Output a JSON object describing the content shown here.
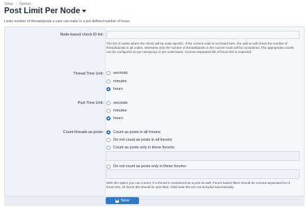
{
  "breadcrumb": {
    "items": [
      "Setup",
      "Options"
    ],
    "separator": "›"
  },
  "page": {
    "title": "Post Limit Per Node",
    "description": "Limits number of threads/posts a user can make in a pre-defined number of hours."
  },
  "fields": {
    "node_ids": {
      "label": "Node-based check ID list:",
      "value": "",
      "hint": "The list of nodes where the check will be node-specific. If the current node is not listed here, the add-on will check the number of threads/posts in all nodes, otherwise only the number of threads/posts in the current node will be considered. The appropriate counts can be configured on per-usergroup or per-node basis. Comma-separated list of forum IDs is expected."
    },
    "thread_time_unit": {
      "label": "Thread Time Unit:",
      "options": [
        "seconds",
        "minutes",
        "hours"
      ],
      "selected": "hours"
    },
    "post_time_unit": {
      "label": "Post Time Unit:",
      "options": [
        "seconds",
        "minutes",
        "hours"
      ],
      "selected": "hours"
    },
    "count_threads": {
      "label": "Count threads as posts:",
      "options": [
        "Count as posts in all forums",
        "Do not count as posts in all forums",
        "Count as posts only in these forums:",
        "Do not count as posts only in these forums:"
      ],
      "selected": "Count as posts in all forums",
      "only_forums_value": "",
      "not_forums_value": "",
      "hint": "With this option you can control, if a thread is considered as a post as well. Forum-based filters should be comma-separated list of forum IDs. All forum IDs should be specified, child node IDs are not included automatically."
    }
  },
  "actions": {
    "save_label": "Save"
  },
  "colors": {
    "accent": "#3478c6",
    "title": "#1f2a38"
  },
  "icons": {
    "save": "save-disk-icon",
    "title_menu": "caret-down-icon"
  }
}
